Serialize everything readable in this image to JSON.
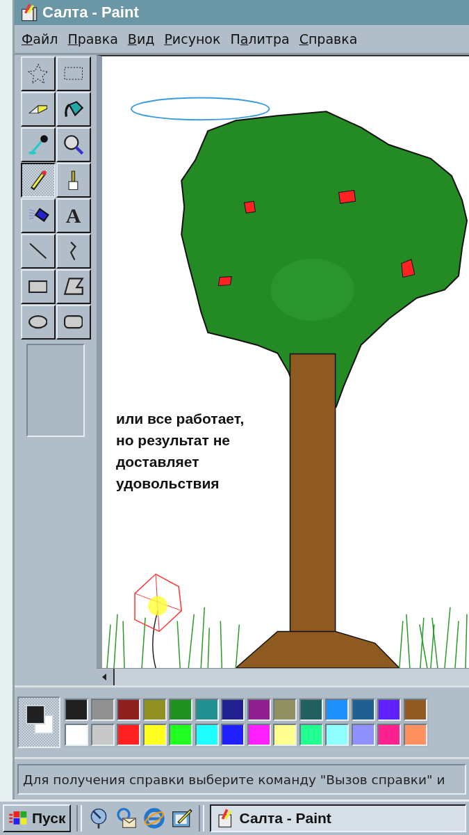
{
  "window": {
    "title": "Салта - Paint"
  },
  "menu": [
    {
      "key": "Ф",
      "rest": "айл"
    },
    {
      "key": "П",
      "rest": "равка"
    },
    {
      "key": "В",
      "rest": "ид"
    },
    {
      "key": "Р",
      "rest": "исунок"
    },
    {
      "pre": "П",
      "key": "а",
      "rest": "литра"
    },
    {
      "key": "С",
      "rest": "правка"
    }
  ],
  "tools": [
    {
      "kind": "free-select",
      "selected": false
    },
    {
      "kind": "select",
      "selected": false
    },
    {
      "kind": "eraser",
      "selected": false
    },
    {
      "kind": "fill",
      "selected": false
    },
    {
      "kind": "picker",
      "selected": false
    },
    {
      "kind": "magnifier",
      "selected": false
    },
    {
      "kind": "pencil",
      "selected": true
    },
    {
      "kind": "brush",
      "selected": false
    },
    {
      "kind": "airbrush",
      "selected": false
    },
    {
      "kind": "text",
      "selected": false,
      "glyph": "A"
    },
    {
      "kind": "line",
      "selected": false
    },
    {
      "kind": "curve",
      "selected": false
    },
    {
      "kind": "rectangle",
      "selected": false
    },
    {
      "kind": "polygon",
      "selected": false
    },
    {
      "kind": "ellipse",
      "selected": false
    },
    {
      "kind": "rounded-rectangle",
      "selected": false
    }
  ],
  "canvas": {
    "caption": "или все работает, но результат не доставляет удовольствия"
  },
  "current_colors": {
    "foreground": {
      "color": "#202020"
    },
    "background": {
      "color": "#ffffff"
    }
  },
  "palette": [
    {
      "color": "#202020"
    },
    {
      "color": "#909090"
    },
    {
      "color": "#902020"
    },
    {
      "color": "#909020"
    },
    {
      "color": "#209020"
    },
    {
      "color": "#209090"
    },
    {
      "color": "#202090"
    },
    {
      "color": "#902090"
    },
    {
      "color": "#909060"
    },
    {
      "color": "#206060"
    },
    {
      "color": "#2090ff"
    },
    {
      "color": "#206090"
    },
    {
      "color": "#6020ff"
    },
    {
      "color": "#905a20"
    },
    {
      "color": "#ffffff"
    },
    {
      "color": "#c8c8c8"
    },
    {
      "color": "#ff2020"
    },
    {
      "color": "#ffff20"
    },
    {
      "color": "#20ff20"
    },
    {
      "color": "#20ffff"
    },
    {
      "color": "#2020ff"
    },
    {
      "color": "#ff20ff"
    },
    {
      "color": "#ffff90"
    },
    {
      "color": "#20ff90"
    },
    {
      "color": "#90ffff"
    },
    {
      "color": "#9090ff"
    },
    {
      "color": "#ff2090"
    },
    {
      "color": "#ff9060"
    }
  ],
  "status_bar": {
    "text": "Для получения справки выберите команду \"Вызов справки\" и"
  },
  "taskbar": {
    "start": "Пуск",
    "task": "Салта - Paint"
  }
}
